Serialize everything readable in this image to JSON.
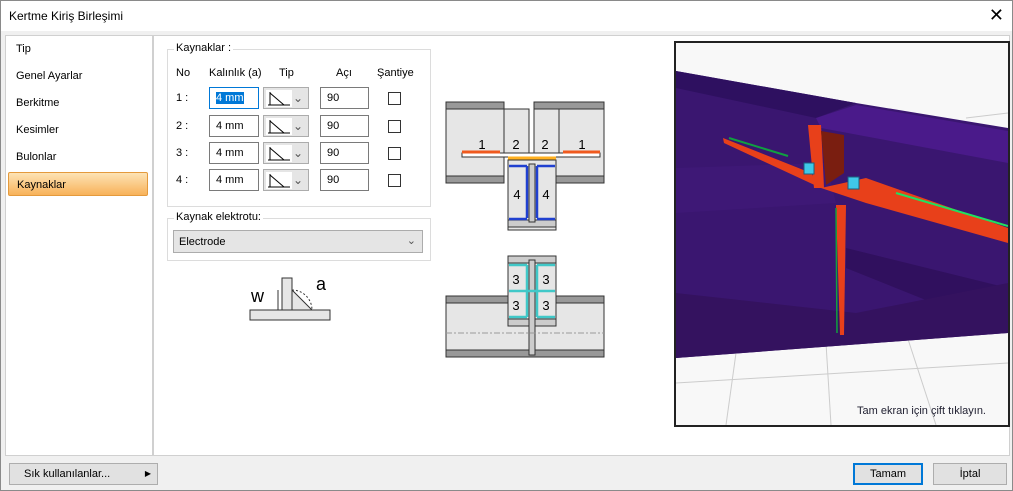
{
  "window": {
    "title": "Kertme Kiriş Birleşimi"
  },
  "sidebar": {
    "items": [
      {
        "label": "Tip"
      },
      {
        "label": "Genel Ayarlar"
      },
      {
        "label": "Berkitme"
      },
      {
        "label": "Kesimler"
      },
      {
        "label": "Bulonlar"
      },
      {
        "label": "Kaynaklar",
        "selected": true
      }
    ]
  },
  "welds": {
    "group_label": "Kaynaklar :",
    "headers": {
      "no": "No",
      "thickness": "Kalınlık (a)",
      "type": "Tip",
      "angle": "Açı",
      "site": "Şantiye"
    },
    "rows": [
      {
        "no": "1 :",
        "thickness": "4 mm",
        "angle": "90",
        "site": false
      },
      {
        "no": "2 :",
        "thickness": "4 mm",
        "angle": "90",
        "site": false
      },
      {
        "no": "3 :",
        "thickness": "4 mm",
        "angle": "90",
        "site": false
      },
      {
        "no": "4 :",
        "thickness": "4 mm",
        "angle": "90",
        "site": false
      }
    ]
  },
  "electrode": {
    "group_label": "Kaynak elektrotu:",
    "value": "Electrode"
  },
  "weld_symbol": {
    "w": "w",
    "a": "a"
  },
  "diagram": {
    "labels": [
      "1",
      "2",
      "2",
      "1",
      "4",
      "4",
      "3",
      "3",
      "3",
      "3"
    ]
  },
  "preview": {
    "hint": "Tam ekran için çift tıklayın."
  },
  "footer": {
    "favorites": "Sık kullanılanlar...",
    "ok": "Tamam",
    "cancel": "İptal"
  },
  "colors": {
    "selection": "#f8b25a",
    "weld1": "#f05a1e",
    "weld2": "#ffb020",
    "weld3": "#40c8c8",
    "weld4": "#2040d0",
    "beam": "#4a1a8a",
    "plate": "#e8401a"
  }
}
